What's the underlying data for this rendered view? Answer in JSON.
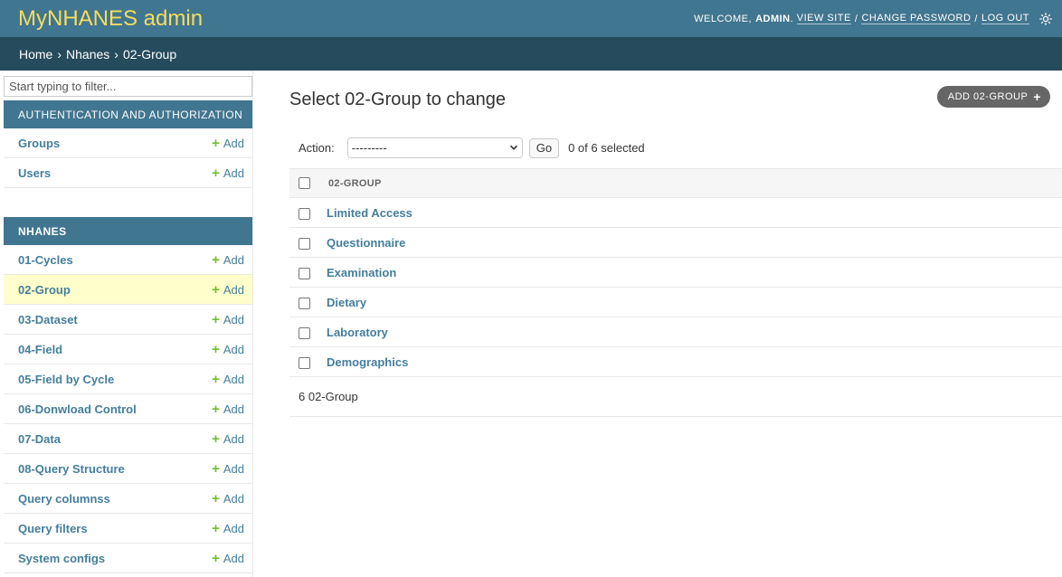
{
  "header": {
    "branding": "MyNHANES admin",
    "welcome": "Welcome,",
    "username": "admin",
    "view_site": "View site",
    "change_password": "Change password",
    "log_out": "Log out",
    "theme_icon": "sun-icon"
  },
  "breadcrumbs": {
    "home": "Home",
    "app": "Nhanes",
    "current": "02-Group",
    "separator": "›"
  },
  "sidebar": {
    "filter_placeholder": "Start typing to filter...",
    "modules": [
      {
        "caption": "Authentication and Authorization",
        "models": [
          {
            "name": "Groups",
            "add": "Add"
          },
          {
            "name": "Users",
            "add": "Add"
          }
        ]
      },
      {
        "caption": "NHANES",
        "models": [
          {
            "name": "01-Cycles",
            "add": "Add"
          },
          {
            "name": "02-Group",
            "add": "Add"
          },
          {
            "name": "03-Dataset",
            "add": "Add"
          },
          {
            "name": "04-Field",
            "add": "Add"
          },
          {
            "name": "05-Field by Cycle",
            "add": "Add"
          },
          {
            "name": "06-Donwload Control",
            "add": "Add"
          },
          {
            "name": "07-Data",
            "add": "Add"
          },
          {
            "name": "08-Query Structure",
            "add": "Add"
          },
          {
            "name": "Query columnss",
            "add": "Add"
          },
          {
            "name": "Query filters",
            "add": "Add"
          },
          {
            "name": "System configs",
            "add": "Add"
          }
        ]
      }
    ]
  },
  "content": {
    "title": "Select 02-Group to change",
    "add_button": "Add 02-Group",
    "action_label": "Action:",
    "action_selected": "---------",
    "go_label": "Go",
    "selected_count": "0 of 6 selected",
    "column_header": "02-Group",
    "rows": [
      "Limited Access",
      "Questionnaire",
      "Examination",
      "Dietary",
      "Laboratory",
      "Demographics"
    ],
    "paginator": "6 02-Group"
  },
  "colors": {
    "header_bg": "#417690",
    "breadcrumbs_bg": "#264b5d",
    "branding": "#f5dd5d",
    "link": "#447e9b",
    "add_plus": "#70bf2b",
    "current_row": "#ffffcc"
  }
}
